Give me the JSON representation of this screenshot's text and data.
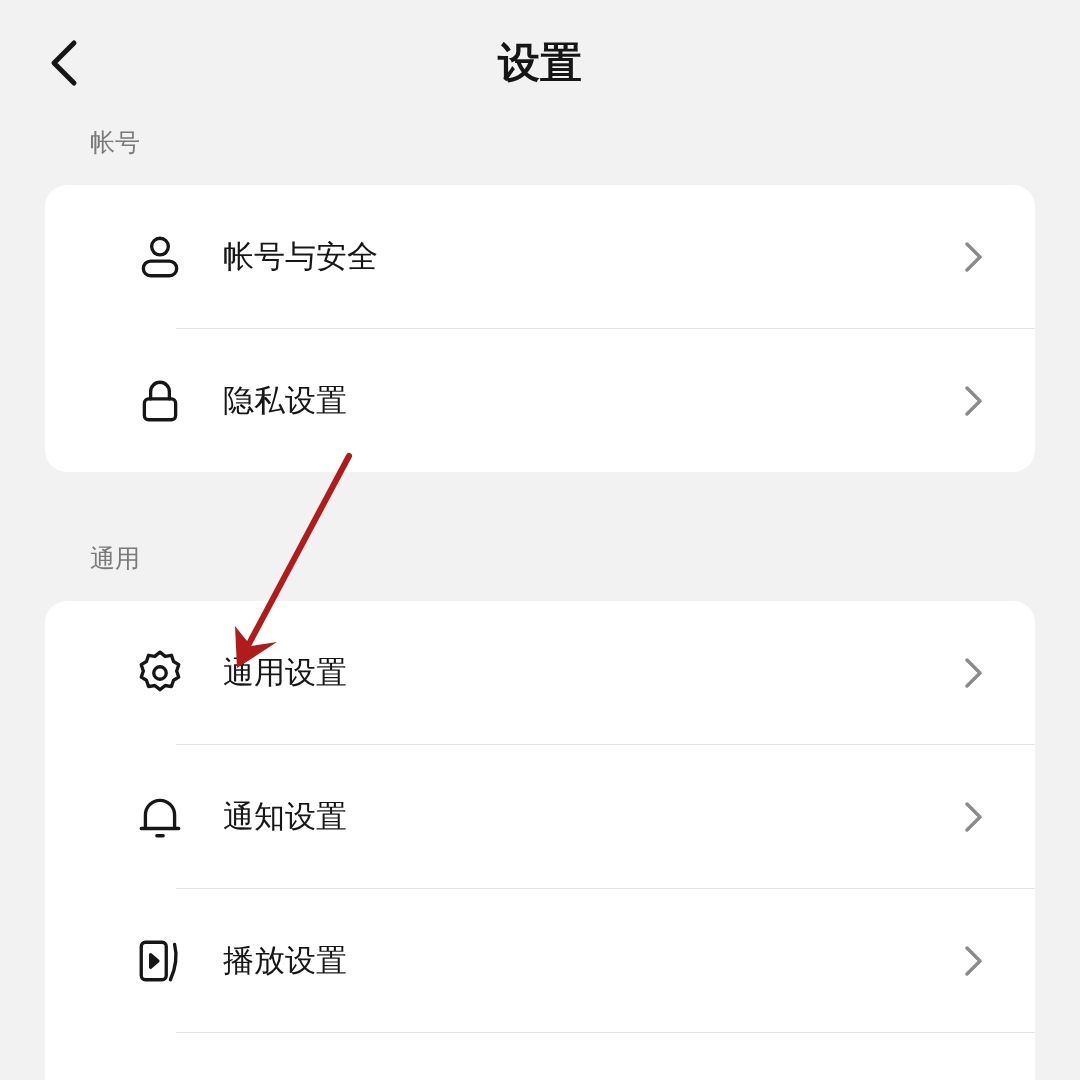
{
  "header": {
    "title": "设置"
  },
  "sections": [
    {
      "label": "帐号",
      "continues": false,
      "items": [
        {
          "label": "帐号与安全",
          "kind": "person"
        },
        {
          "label": "隐私设置",
          "kind": "lock"
        }
      ]
    },
    {
      "label": "通用",
      "continues": true,
      "items": [
        {
          "label": "通用设置",
          "kind": "gear"
        },
        {
          "label": "通知设置",
          "kind": "bell"
        },
        {
          "label": "播放设置",
          "kind": "player"
        }
      ]
    }
  ]
}
